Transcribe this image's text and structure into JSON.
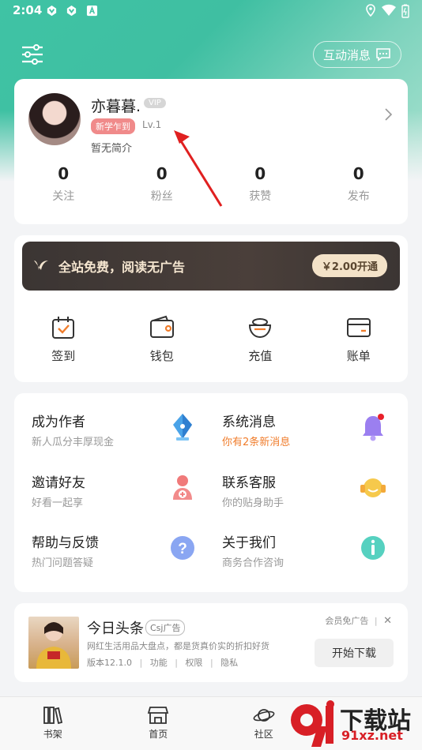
{
  "status": {
    "time": "2:04"
  },
  "header": {
    "messages_label": "互动消息"
  },
  "profile": {
    "name": "亦暮暮.",
    "vip_badge": "VIP",
    "new_tag": "新学乍到",
    "level": "Lv.1",
    "intro": "暂无简介",
    "stats": [
      {
        "value": "0",
        "label": "关注"
      },
      {
        "value": "0",
        "label": "粉丝"
      },
      {
        "value": "0",
        "label": "获赞"
      },
      {
        "value": "0",
        "label": "发布"
      }
    ]
  },
  "vip": {
    "banner_text": "全站免费，阅读无广告",
    "button_label": "￥2.00开通"
  },
  "quick_actions": [
    {
      "label": "签到",
      "icon": "calendar-check-icon"
    },
    {
      "label": "钱包",
      "icon": "wallet-icon"
    },
    {
      "label": "充值",
      "icon": "coin-pot-icon"
    },
    {
      "label": "账单",
      "icon": "bill-card-icon"
    }
  ],
  "menu": [
    {
      "title": "成为作者",
      "subtitle": "新人瓜分丰厚现金",
      "icon": "pen-nib-icon"
    },
    {
      "title": "系统消息",
      "subtitle": "你有2条新消息",
      "icon": "bell-icon"
    },
    {
      "title": "邀请好友",
      "subtitle": "好看一起享",
      "icon": "add-user-icon"
    },
    {
      "title": "联系客服",
      "subtitle": "你的贴身助手",
      "icon": "headset-icon"
    },
    {
      "title": "帮助与反馈",
      "subtitle": "热门问题答疑",
      "icon": "question-icon"
    },
    {
      "title": "关于我们",
      "subtitle": "商务合作咨询",
      "icon": "info-icon"
    }
  ],
  "ad": {
    "title": "今日头条",
    "tag": "Csj广告",
    "description": "网红生活用品大盘点，都是货真价实的折扣好货",
    "version": "版本12.1.0",
    "links": [
      "功能",
      "权限",
      "隐私"
    ],
    "vip_free": "会员免广告",
    "download_label": "开始下载"
  },
  "tabs": [
    {
      "label": "书架",
      "icon": "bookshelf-icon"
    },
    {
      "label": "首页",
      "icon": "home-store-icon"
    },
    {
      "label": "社区",
      "icon": "planet-icon"
    }
  ],
  "watermark": {
    "text": "下载站",
    "url": "91xz.net"
  },
  "colors": {
    "accent": "#3fc3a4",
    "highlight": "#f07d2c",
    "arrow": "#e02020"
  }
}
